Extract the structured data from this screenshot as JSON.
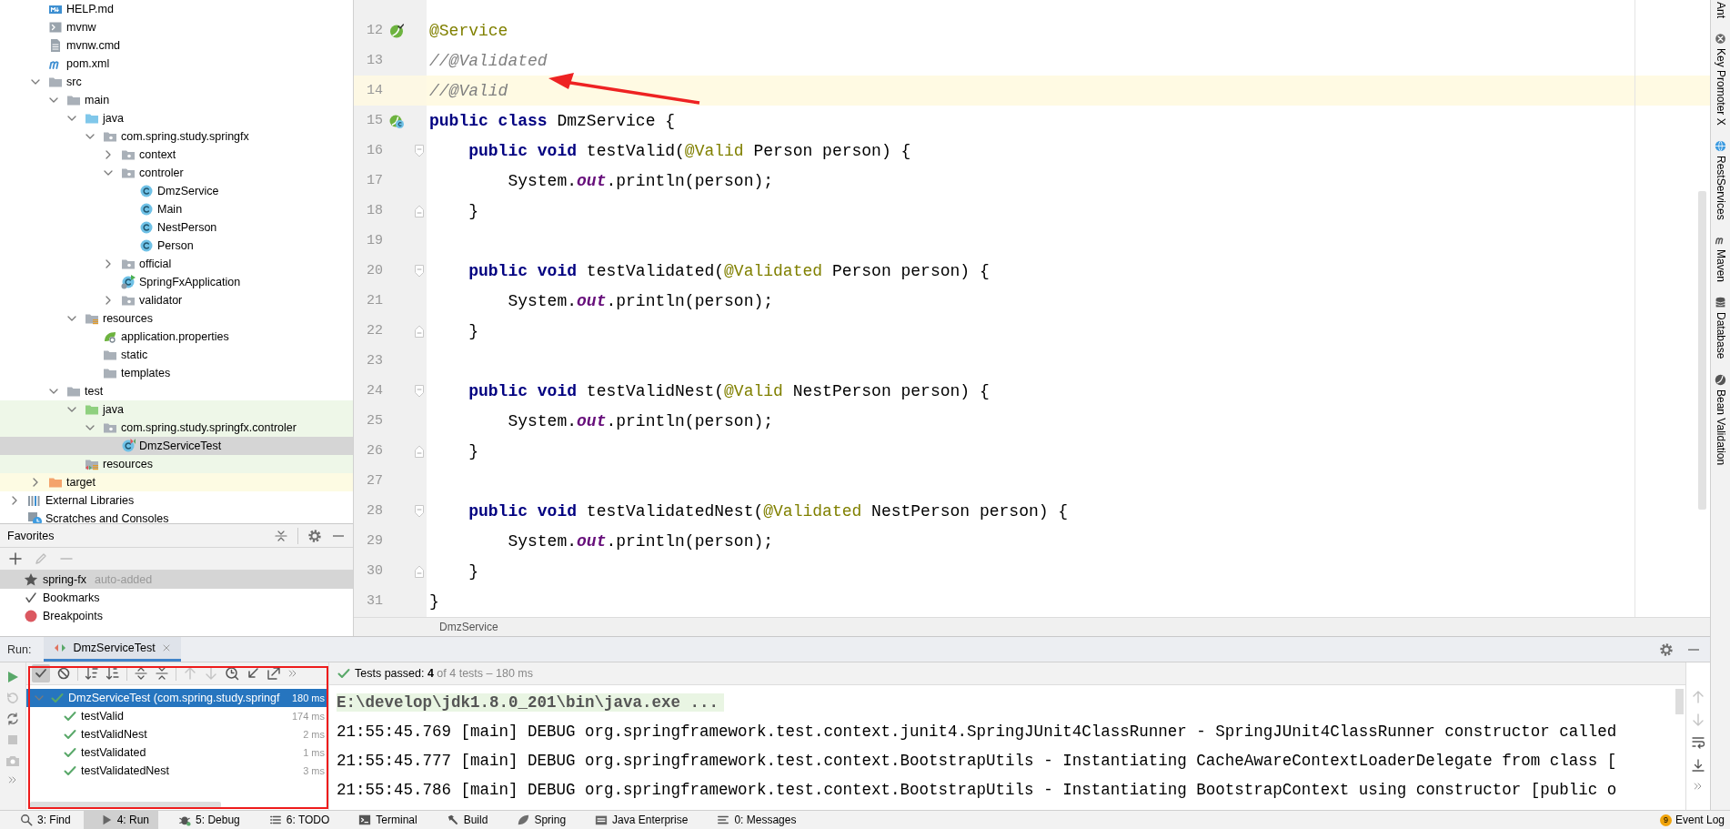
{
  "project_tree": {
    "items": [
      {
        "label": "HELP.md",
        "kind": "markdown",
        "selected": false
      },
      {
        "label": "mvnw",
        "kind": "script",
        "selected": false
      },
      {
        "label": "mvnw.cmd",
        "kind": "text",
        "selected": false
      },
      {
        "label": "pom.xml",
        "kind": "maven",
        "selected": false
      },
      {
        "label": "src",
        "kind": "folder",
        "expanded": true,
        "selected": false,
        "children": [
          {
            "label": "main",
            "kind": "folder",
            "expanded": true,
            "selected": false,
            "children": [
              {
                "label": "java",
                "kind": "source-folder",
                "expanded": true,
                "selected": false,
                "children": [
                  {
                    "label": "com.spring.study.springfx",
                    "kind": "package",
                    "expanded": true,
                    "selected": false,
                    "children": [
                      {
                        "label": "context",
                        "kind": "package",
                        "expanded": false,
                        "selected": false
                      },
                      {
                        "label": "controler",
                        "kind": "package",
                        "expanded": true,
                        "selected": false,
                        "children": [
                          {
                            "label": "DmzService",
                            "kind": "class",
                            "selected": false
                          },
                          {
                            "label": "Main",
                            "kind": "class",
                            "selected": false
                          },
                          {
                            "label": "NestPerson",
                            "kind": "class",
                            "selected": false
                          },
                          {
                            "label": "Person",
                            "kind": "class",
                            "selected": false
                          }
                        ]
                      },
                      {
                        "label": "official",
                        "kind": "package",
                        "expanded": false,
                        "selected": false
                      },
                      {
                        "label": "SpringFxApplication",
                        "kind": "spring-class",
                        "selected": false
                      },
                      {
                        "label": "validator",
                        "kind": "package",
                        "expanded": false,
                        "selected": false
                      }
                    ]
                  }
                ]
              },
              {
                "label": "resources",
                "kind": "resources-folder",
                "expanded": true,
                "selected": false,
                "children": [
                  {
                    "label": "application.properties",
                    "kind": "properties",
                    "selected": false
                  },
                  {
                    "label": "static",
                    "kind": "folder",
                    "selected": false
                  },
                  {
                    "label": "templates",
                    "kind": "folder",
                    "selected": false
                  }
                ]
              }
            ]
          },
          {
            "label": "test",
            "kind": "folder",
            "expanded": true,
            "selected": false,
            "children": [
              {
                "label": "java",
                "kind": "test-folder",
                "test_source": true,
                "expanded": true,
                "selected": false,
                "children": [
                  {
                    "label": "com.spring.study.springfx.controler",
                    "kind": "package",
                    "test_source": true,
                    "expanded": true,
                    "selected": false,
                    "children": [
                      {
                        "label": "DmzServiceTest",
                        "kind": "test-class",
                        "test_source": true,
                        "selected": true
                      }
                    ]
                  }
                ]
              },
              {
                "label": "resources",
                "kind": "test-resources-folder",
                "test_source": true,
                "selected": false
              }
            ]
          }
        ]
      },
      {
        "label": "target",
        "kind": "excluded-folder",
        "excluded": true,
        "expanded": false,
        "selected": false
      }
    ],
    "roots": [
      {
        "label": "External Libraries",
        "kind": "libraries",
        "expanded": false,
        "selected": false
      },
      {
        "label": "Scratches and Consoles",
        "kind": "scratches",
        "selected": false
      }
    ]
  },
  "favorites": {
    "title": "Favorites",
    "items": [
      {
        "label": "spring-fx",
        "note": "auto-added",
        "kind": "star",
        "selected": true
      },
      {
        "label": "Bookmarks",
        "kind": "bookmark",
        "selected": false
      },
      {
        "label": "Breakpoints",
        "kind": "breakpoint",
        "selected": false
      }
    ]
  },
  "editor": {
    "lines": [
      {
        "number": "12",
        "current": false,
        "gutter": {
          "kind": "bean-check"
        },
        "tokens": [
          {
            "text": "@Service",
            "kind": "annotation"
          }
        ]
      },
      {
        "number": "13",
        "current": false,
        "tokens": [
          {
            "text": "//@Validated",
            "kind": "comment"
          }
        ]
      },
      {
        "number": "14",
        "current": true,
        "tokens": [
          {
            "text": "//@Valid",
            "kind": "comment"
          }
        ]
      },
      {
        "number": "15",
        "current": false,
        "gutter": {
          "kind": "bean-class"
        },
        "tokens": [
          {
            "text": "public class",
            "kind": "keyword"
          },
          {
            "text": " DmzService {",
            "kind": "plain"
          }
        ]
      },
      {
        "number": "16",
        "current": false,
        "fold": {
          "kind": "start"
        },
        "tokens": [
          {
            "text": "    public void",
            "kind": "keyword"
          },
          {
            "text": " testValid(",
            "kind": "plain"
          },
          {
            "text": "@Valid",
            "kind": "annotation"
          },
          {
            "text": " Person person) {",
            "kind": "plain"
          }
        ]
      },
      {
        "number": "17",
        "current": false,
        "tokens": [
          {
            "text": "        System.",
            "kind": "plain"
          },
          {
            "text": "out",
            "kind": "field"
          },
          {
            "text": ".println(person);",
            "kind": "plain"
          }
        ]
      },
      {
        "number": "18",
        "current": false,
        "fold": {
          "kind": "end"
        },
        "tokens": [
          {
            "text": "    }",
            "kind": "plain"
          }
        ]
      },
      {
        "number": "19",
        "current": false
      },
      {
        "number": "20",
        "current": false,
        "fold": {
          "kind": "start"
        },
        "tokens": [
          {
            "text": "    public void",
            "kind": "keyword"
          },
          {
            "text": " testValidated(",
            "kind": "plain"
          },
          {
            "text": "@Validated",
            "kind": "annotation"
          },
          {
            "text": " Person person) {",
            "kind": "plain"
          }
        ]
      },
      {
        "number": "21",
        "current": false,
        "tokens": [
          {
            "text": "        System.",
            "kind": "plain"
          },
          {
            "text": "out",
            "kind": "field"
          },
          {
            "text": ".println(person);",
            "kind": "plain"
          }
        ]
      },
      {
        "number": "22",
        "current": false,
        "fold": {
          "kind": "end"
        },
        "tokens": [
          {
            "text": "    }",
            "kind": "plain"
          }
        ]
      },
      {
        "number": "23",
        "current": false
      },
      {
        "number": "24",
        "current": false,
        "fold": {
          "kind": "start"
        },
        "tokens": [
          {
            "text": "    public void",
            "kind": "keyword"
          },
          {
            "text": " testValidNest(",
            "kind": "plain"
          },
          {
            "text": "@Valid",
            "kind": "annotation"
          },
          {
            "text": " NestPerson person) {",
            "kind": "plain"
          }
        ]
      },
      {
        "number": "25",
        "current": false,
        "tokens": [
          {
            "text": "        System.",
            "kind": "plain"
          },
          {
            "text": "out",
            "kind": "field"
          },
          {
            "text": ".println(person);",
            "kind": "plain"
          }
        ]
      },
      {
        "number": "26",
        "current": false,
        "fold": {
          "kind": "end"
        },
        "tokens": [
          {
            "text": "    }",
            "kind": "plain"
          }
        ]
      },
      {
        "number": "27",
        "current": false
      },
      {
        "number": "28",
        "current": false,
        "fold": {
          "kind": "start"
        },
        "tokens": [
          {
            "text": "    public void",
            "kind": "keyword"
          },
          {
            "text": " testValidatedNest(",
            "kind": "plain"
          },
          {
            "text": "@Validated",
            "kind": "annotation"
          },
          {
            "text": " NestPerson person) {",
            "kind": "plain"
          }
        ]
      },
      {
        "number": "29",
        "current": false,
        "tokens": [
          {
            "text": "        System.",
            "kind": "plain"
          },
          {
            "text": "out",
            "kind": "field"
          },
          {
            "text": ".println(person);",
            "kind": "plain"
          }
        ]
      },
      {
        "number": "30",
        "current": false,
        "fold": {
          "kind": "end"
        },
        "tokens": [
          {
            "text": "    }",
            "kind": "plain"
          }
        ]
      },
      {
        "number": "31",
        "current": false,
        "tokens": [
          {
            "text": "}",
            "kind": "plain"
          }
        ]
      }
    ],
    "breadcrumb": "DmzService"
  },
  "run_panel": {
    "label": "Run:",
    "tab": {
      "title": "DmzServiceTest",
      "selected": true
    },
    "show_passed": true,
    "summary": {
      "label": "Tests passed:",
      "count": "4",
      "detail": "of 4 tests – 180 ms"
    },
    "tests": {
      "name": "DmzServiceTest (com.spring.study.springf",
      "duration": "180 ms",
      "passed": true,
      "expanded": true,
      "selected": true,
      "children": [
        {
          "name": "testValid",
          "duration": "174 ms",
          "passed": true,
          "selected": false
        },
        {
          "name": "testValidNest",
          "duration": "2 ms",
          "passed": true,
          "selected": false
        },
        {
          "name": "testValidated",
          "duration": "1 ms",
          "passed": true,
          "selected": false
        },
        {
          "name": "testValidatedNest",
          "duration": "3 ms",
          "passed": true,
          "selected": false
        }
      ]
    },
    "console": [
      {
        "text": "E:\\develop\\jdk1.8.0_201\\bin\\java.exe ...",
        "kind": "command"
      },
      {
        "text": "21:55:45.769 [main] DEBUG org.springframework.test.context.junit4.SpringJUnit4ClassRunner - SpringJUnit4ClassRunner constructor called",
        "kind": "log"
      },
      {
        "text": "21:55:45.777 [main] DEBUG org.springframework.test.context.BootstrapUtils - Instantiating CacheAwareContextLoaderDelegate from class [",
        "kind": "log"
      },
      {
        "text": "21:55:45.786 [main] DEBUG org.springframework.test.context.BootstrapUtils - Instantiating BootstrapContext using constructor [public o",
        "kind": "log"
      }
    ]
  },
  "right_sidebar": [
    {
      "label": "Ant",
      "kind": "ant"
    },
    {
      "label": "Key Promoter X",
      "kind": "key-promoter"
    },
    {
      "label": "RestServices",
      "kind": "rest"
    },
    {
      "label": "Maven",
      "kind": "maven"
    },
    {
      "label": "Database",
      "kind": "database"
    },
    {
      "label": "Bean Validation",
      "kind": "bean-validation"
    }
  ],
  "status_bar": {
    "tools": [
      {
        "label": "3: Find",
        "kind": "find",
        "selected": false
      },
      {
        "label": "4: Run",
        "kind": "run",
        "selected": true
      },
      {
        "label": "5: Debug",
        "kind": "debug",
        "selected": false
      },
      {
        "label": "6: TODO",
        "kind": "todo",
        "selected": false
      },
      {
        "label": "Terminal",
        "kind": "terminal",
        "selected": false
      },
      {
        "label": "Build",
        "kind": "build",
        "selected": false
      },
      {
        "label": "Spring",
        "kind": "spring",
        "selected": false
      },
      {
        "label": "Java Enterprise",
        "kind": "enterprise",
        "selected": false
      },
      {
        "label": "0: Messages",
        "kind": "messages",
        "selected": false
      }
    ],
    "event_log": {
      "label": "Event Log",
      "count": "9"
    }
  }
}
